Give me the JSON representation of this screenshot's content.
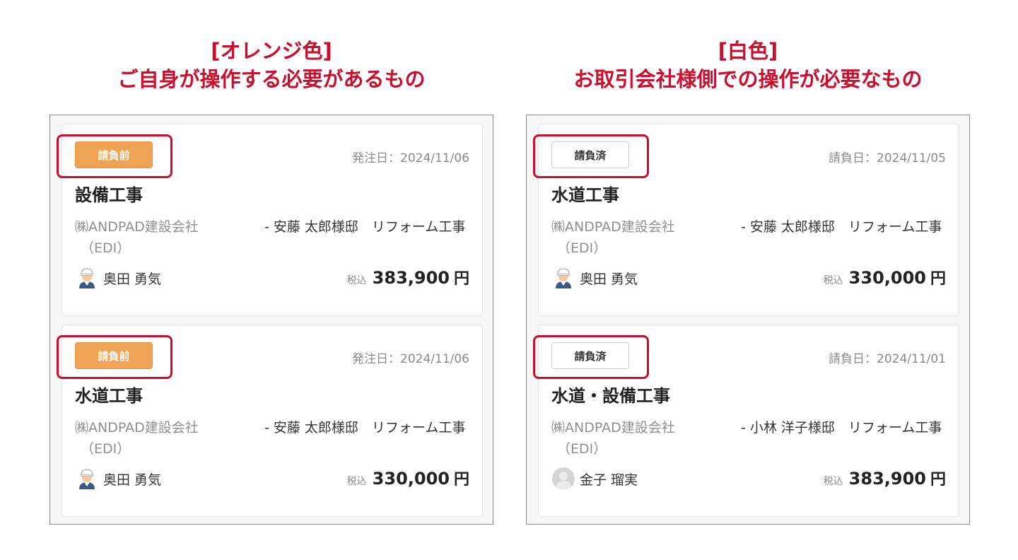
{
  "left_heading": {
    "line1": "[オレンジ色]",
    "line2": "ご自身が操作する必要があるもの"
  },
  "right_heading": {
    "line1": "[白色]",
    "line2": "お取引会社様側での操作が必要なもの"
  },
  "tax_label": "税込",
  "yen": "円",
  "left_cards": [
    {
      "status": "請負前",
      "status_style": "orange",
      "date": "発注日：2024/11/06",
      "title": "設備工事",
      "company": "㈱ANDPAD建設会社",
      "company_sub": "（EDI）",
      "project": "- 安藤 太郎様邸　リフォーム工事",
      "person": "奥田 勇気",
      "avatar": "worker-avatar-icon",
      "amount": "383,900"
    },
    {
      "status": "請負前",
      "status_style": "orange",
      "date": "発注日：2024/11/06",
      "title": "水道工事",
      "company": "㈱ANDPAD建設会社",
      "company_sub": "（EDI）",
      "project": "- 安藤 太郎様邸　リフォーム工事",
      "person": "奥田 勇気",
      "avatar": "worker-avatar-icon",
      "amount": "330,000"
    }
  ],
  "right_cards": [
    {
      "status": "請負済",
      "status_style": "white",
      "date": "請負日：2024/11/05",
      "title": "水道工事",
      "company": "㈱ANDPAD建設会社",
      "company_sub": "（EDI）",
      "project": "- 安藤 太郎様邸　リフォーム工事",
      "person": "奥田 勇気",
      "avatar": "worker-avatar-icon",
      "amount": "330,000"
    },
    {
      "status": "請負済",
      "status_style": "white",
      "date": "請負日：2024/11/01",
      "title": "水道・設備工事",
      "company": "㈱ANDPAD建設会社",
      "company_sub": "（EDI）",
      "project": "- 小林 洋子様邸　リフォーム工事",
      "person": "金子 瑠実",
      "avatar": "default-user-avatar-icon",
      "amount": "383,900"
    }
  ],
  "colors": {
    "highlight": "#c8102e",
    "badge_orange": "#efa455"
  }
}
